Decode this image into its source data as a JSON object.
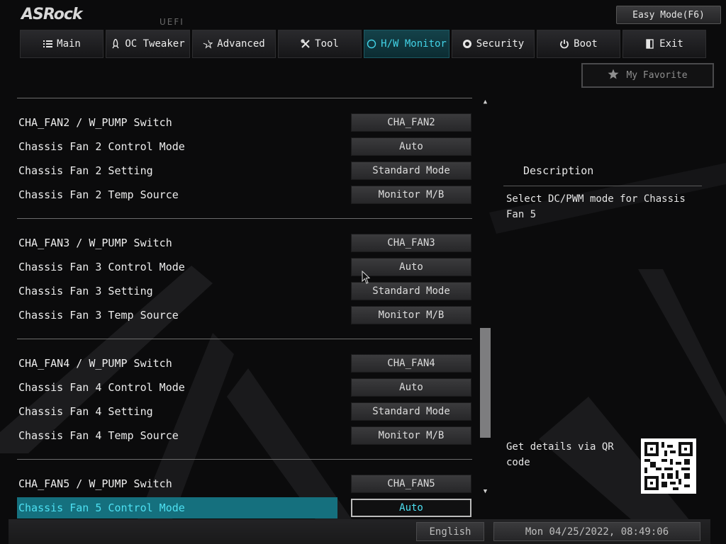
{
  "header": {
    "logo": "ASRock",
    "uefi": "UEFI",
    "easy_mode": "Easy Mode(F6)"
  },
  "nav": {
    "tabs": [
      {
        "label": "Main",
        "icon": "list-icon",
        "active": false
      },
      {
        "label": "OC Tweaker",
        "icon": "rocket-icon",
        "active": false
      },
      {
        "label": "Advanced",
        "icon": "star-icon",
        "active": false
      },
      {
        "label": "Tool",
        "icon": "tools-icon",
        "active": false
      },
      {
        "label": "H/W Monitor",
        "icon": "monitor-icon",
        "active": true
      },
      {
        "label": "Security",
        "icon": "shield-icon",
        "active": false
      },
      {
        "label": "Boot",
        "icon": "power-icon",
        "active": false
      },
      {
        "label": "Exit",
        "icon": "exit-icon",
        "active": false
      }
    ]
  },
  "favorite": {
    "label": "My Favorite",
    "icon": "star-icon"
  },
  "settings": {
    "groups": [
      {
        "rows": [
          {
            "label": "CHA_FAN2 / W_PUMP Switch",
            "value": "CHA_FAN2"
          },
          {
            "label": "Chassis Fan 2 Control Mode",
            "value": "Auto"
          },
          {
            "label": "Chassis Fan 2 Setting",
            "value": "Standard Mode"
          },
          {
            "label": "Chassis Fan 2 Temp Source",
            "value": "Monitor M/B"
          }
        ]
      },
      {
        "rows": [
          {
            "label": "CHA_FAN3 / W_PUMP Switch",
            "value": "CHA_FAN3"
          },
          {
            "label": "Chassis Fan 3 Control Mode",
            "value": "Auto"
          },
          {
            "label": "Chassis Fan 3 Setting",
            "value": "Standard Mode"
          },
          {
            "label": "Chassis Fan 3 Temp Source",
            "value": "Monitor M/B"
          }
        ]
      },
      {
        "rows": [
          {
            "label": "CHA_FAN4 / W_PUMP Switch",
            "value": "CHA_FAN4"
          },
          {
            "label": "Chassis Fan 4 Control Mode",
            "value": "Auto"
          },
          {
            "label": "Chassis Fan 4 Setting",
            "value": "Standard Mode"
          },
          {
            "label": "Chassis Fan 4 Temp Source",
            "value": "Monitor M/B"
          }
        ]
      },
      {
        "rows": [
          {
            "label": "CHA_FAN5 / W_PUMP Switch",
            "value": "CHA_FAN5"
          },
          {
            "label": "Chassis Fan 5 Control Mode",
            "value": "Auto",
            "selected": true
          }
        ]
      }
    ]
  },
  "description": {
    "title": "Description",
    "text": "Select DC/PWM mode for Chassis Fan 5",
    "qr_text": "Get details via QR code"
  },
  "statusbar": {
    "language": "English",
    "datetime": "Mon 04/25/2022, 08:49:06"
  },
  "colors": {
    "accent": "#42d2e6",
    "selected_row": "#15707e",
    "active_tab": "#14424a"
  }
}
